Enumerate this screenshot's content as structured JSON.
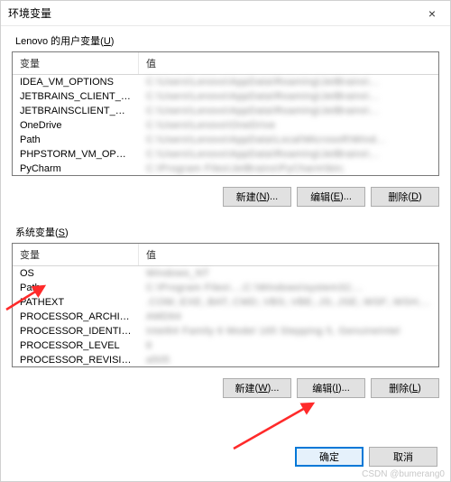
{
  "window": {
    "title": "环境变量",
    "close_label": "×"
  },
  "user_vars": {
    "label": "Lenovo 的用户变量",
    "mnemonic": "U",
    "columns": {
      "name": "变量",
      "value": "值"
    },
    "rows": [
      {
        "name": "IDEA_VM_OPTIONS",
        "value": "C:\\Users\\Lenovo\\AppData\\Roaming\\JetBrains\\..."
      },
      {
        "name": "JETBRAINS_CLIENT_VM_O...",
        "value": "C:\\Users\\Lenovo\\AppData\\Roaming\\JetBrains\\..."
      },
      {
        "name": "JETBRAINSCLIENT_VM_O...",
        "value": "C:\\Users\\Lenovo\\AppData\\Roaming\\JetBrains\\..."
      },
      {
        "name": "OneDrive",
        "value": "C:\\Users\\Lenovo\\OneDrive"
      },
      {
        "name": "Path",
        "value": "C:\\Users\\Lenovo\\AppData\\Local\\Microsoft\\Wind..."
      },
      {
        "name": "PHPSTORM_VM_OPTIONS",
        "value": "C:\\Users\\Lenovo\\AppData\\Roaming\\JetBrains\\..."
      },
      {
        "name": "PyCharm",
        "value": "C:\\Program Files\\JetBrains\\PyCharm\\bin;"
      }
    ],
    "buttons": {
      "new": "新建",
      "new_m": "N",
      "edit": "编辑",
      "edit_m": "E",
      "delete": "删除",
      "delete_m": "D"
    }
  },
  "system_vars": {
    "label": "系统变量",
    "mnemonic": "S",
    "columns": {
      "name": "变量",
      "value": "值"
    },
    "rows": [
      {
        "name": "OS",
        "value": "Windows_NT"
      },
      {
        "name": "Path",
        "value": "C:\\Program Files\\...;C:\\Windows\\system32;..."
      },
      {
        "name": "PATHEXT",
        "value": ".COM;.EXE;.BAT;.CMD;.VBS;.VBE;.JS;.JSE;.WSF;.WSH;..."
      },
      {
        "name": "PROCESSOR_ARCHITECT...",
        "value": "AMD64"
      },
      {
        "name": "PROCESSOR_IDENTIFIER",
        "value": "Intel64 Family 6 Model 165 Stepping 5, GenuineIntel"
      },
      {
        "name": "PROCESSOR_LEVEL",
        "value": "6"
      },
      {
        "name": "PROCESSOR_REVISION",
        "value": "a505"
      }
    ],
    "buttons": {
      "new": "新建",
      "new_m": "W",
      "edit": "编辑",
      "edit_m": "I",
      "delete": "删除",
      "delete_m": "L"
    }
  },
  "dialog_buttons": {
    "ok": "确定",
    "cancel": "取消"
  },
  "watermark": "CSDN @bumerang0"
}
